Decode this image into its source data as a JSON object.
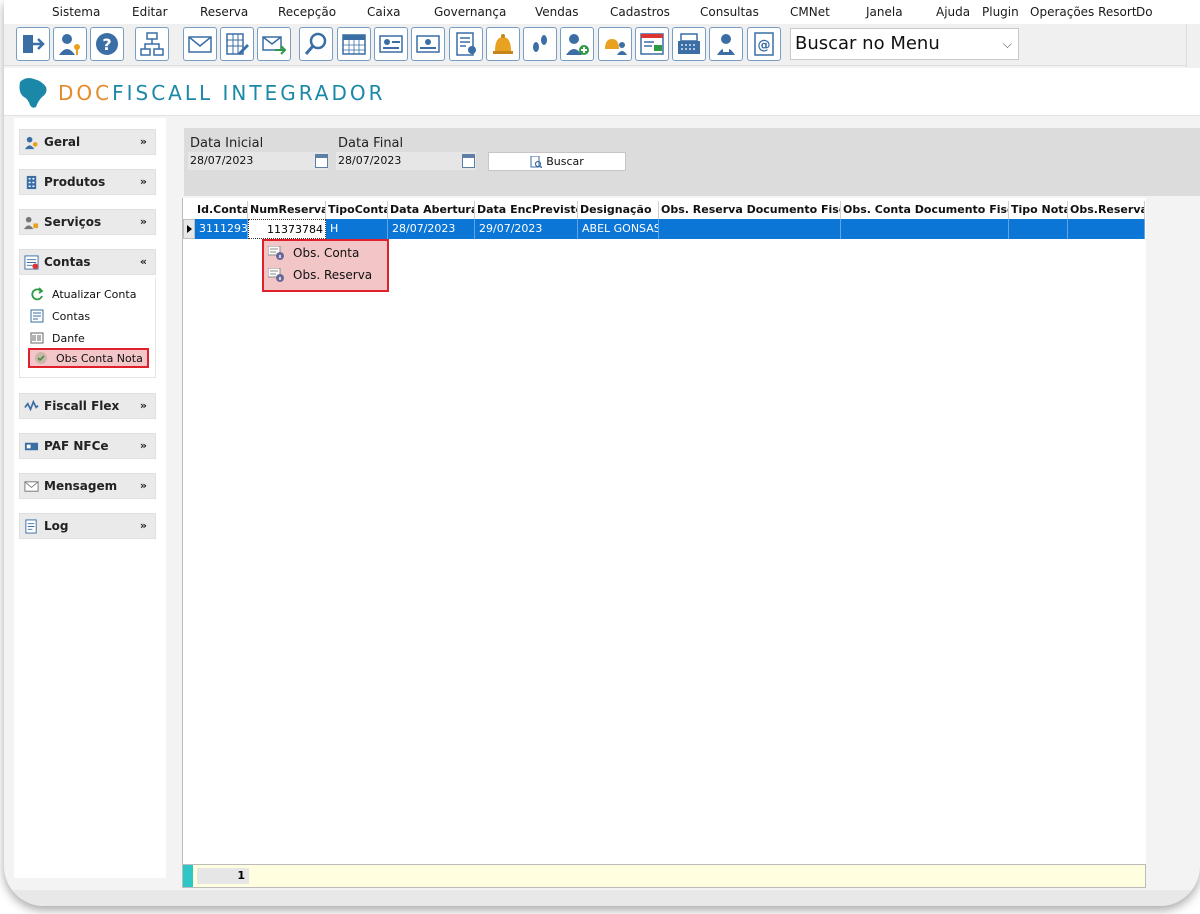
{
  "menubar": {
    "items": [
      "Sistema",
      "Editar",
      "Reserva",
      "Recepção",
      "Caixa",
      "Governança",
      "Vendas",
      "Cadastros",
      "Consultas",
      "CMNet",
      "Janela",
      "Ajuda",
      "Plugin",
      "Operações Resort",
      "Do"
    ]
  },
  "toolbar": {
    "icons": [
      "exit-icon",
      "user-key-icon",
      "help-icon",
      "org-chart-icon",
      "mail-icon",
      "spreadsheet-edit-icon",
      "mail-forward-icon",
      "search-icon",
      "calendar-icon",
      "guest-card-icon",
      "guest-card-2-icon",
      "report-user-icon",
      "bell-icon",
      "footprints-icon",
      "add-user-icon",
      "bell-user-icon",
      "invoice-icon",
      "cash-register-icon",
      "maid-icon",
      "email-book-icon"
    ],
    "search_menu": "Buscar no Menu"
  },
  "brand": {
    "doc": "DOC",
    "rest": "FISCALL INTEGRADOR"
  },
  "sidebar": {
    "sections": [
      {
        "label": "Geral",
        "icon": "users-icon",
        "chevron": "»"
      },
      {
        "label": "Produtos",
        "icon": "building-icon",
        "chevron": "»"
      },
      {
        "label": "Serviços",
        "icon": "service-icon",
        "chevron": "»"
      },
      {
        "label": "Contas",
        "icon": "accounts-icon",
        "chevron": "«"
      },
      {
        "label": "Fiscall Flex",
        "icon": "wave-icon",
        "chevron": "»"
      },
      {
        "label": "PAF NFCe",
        "icon": "paf-icon",
        "chevron": "»"
      },
      {
        "label": "Mensagem",
        "icon": "envelope-icon",
        "chevron": "»"
      },
      {
        "label": "Log",
        "icon": "log-icon",
        "chevron": "»"
      }
    ],
    "contas_items": [
      "Atualizar Conta",
      "Contas",
      "Danfe",
      "Obs Conta Nota"
    ]
  },
  "filter": {
    "data_inicial_label": "Data Inicial",
    "data_inicial_value": "28/07/2023",
    "data_final_label": "Data Final",
    "data_final_value": "28/07/2023",
    "buscar_label": "Buscar"
  },
  "grid": {
    "columns": [
      "Id.Conta",
      "NumReserva",
      "TipoConta",
      "Data Abertura",
      "Data EncPrevisto",
      "Designação",
      "Obs. Reserva Documento Fiscal",
      "Obs. Conta Documento Fiscal",
      "Tipo Nota",
      "Obs.Reserva"
    ],
    "rows": [
      [
        "3111293",
        "11373784",
        "H",
        "28/07/2023",
        "29/07/2023",
        "ABEL GONSAS",
        "",
        "",
        "",
        ""
      ]
    ]
  },
  "context_menu": {
    "items": [
      "Obs. Conta",
      "Obs. Reserva"
    ]
  },
  "footer": {
    "record_count": "1"
  }
}
